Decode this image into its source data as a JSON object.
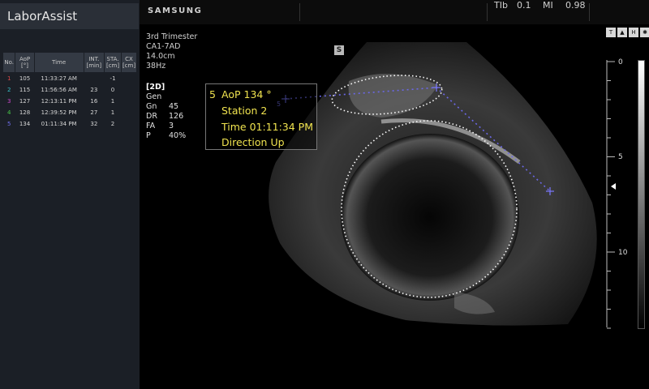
{
  "app": {
    "title": "LaborAssist"
  },
  "table": {
    "headers": [
      {
        "line1": "No.",
        "line2": ""
      },
      {
        "line1": "AoP",
        "line2": "[°]"
      },
      {
        "line1": "Time",
        "line2": ""
      },
      {
        "line1": "INT.",
        "line2": "[min]"
      },
      {
        "line1": "STA.",
        "line2": "[cm]"
      },
      {
        "line1": "CX",
        "line2": "[cm]"
      }
    ],
    "rows": [
      {
        "no": "1",
        "aop": "105",
        "time": "11:33:27 AM",
        "int": "",
        "sta": "-1",
        "cx": "",
        "color": "#e04848"
      },
      {
        "no": "2",
        "aop": "115",
        "time": "11:56:56 AM",
        "int": "23",
        "sta": "0",
        "cx": "",
        "color": "#38c0c8"
      },
      {
        "no": "3",
        "aop": "127",
        "time": "12:13:11 PM",
        "int": "16",
        "sta": "1",
        "cx": "",
        "color": "#d048d0"
      },
      {
        "no": "4",
        "aop": "128",
        "time": "12:39:52 PM",
        "int": "27",
        "sta": "1",
        "cx": "",
        "color": "#48c848"
      },
      {
        "no": "5",
        "aop": "134",
        "time": "01:11:34 PM",
        "int": "32",
        "sta": "2",
        "cx": "",
        "color": "#7070f0"
      }
    ]
  },
  "header": {
    "brand": "SAMSUNG",
    "tib_label": "TIb",
    "tib_value": "0.1",
    "mi_label": "MI",
    "mi_value": "0.98"
  },
  "scan_info": {
    "preset": "3rd Trimester",
    "probe": "CA1-7AD",
    "depth": "14.0cm",
    "frequency": "38Hz"
  },
  "params": {
    "mode": "[2D]",
    "gen": "Gen",
    "items": [
      {
        "label": "Gn",
        "value": "45"
      },
      {
        "label": "DR",
        "value": "126"
      },
      {
        "label": "FA",
        "value": "3"
      },
      {
        "label": "P",
        "value": "40%"
      }
    ]
  },
  "marker": {
    "label": "S"
  },
  "measurement": {
    "number": "5",
    "aop": "AoP  134 °",
    "station": "Station  2",
    "time": "Time  01:11:34 PM",
    "direction": "Direction  Up",
    "color": "#f0e34f"
  },
  "cursor": {
    "label": "5"
  },
  "depth_scale": {
    "labels": [
      "0",
      "5",
      "10"
    ]
  },
  "colors": {
    "measure_line": "#6b68e8",
    "trace": "#ffffff"
  }
}
